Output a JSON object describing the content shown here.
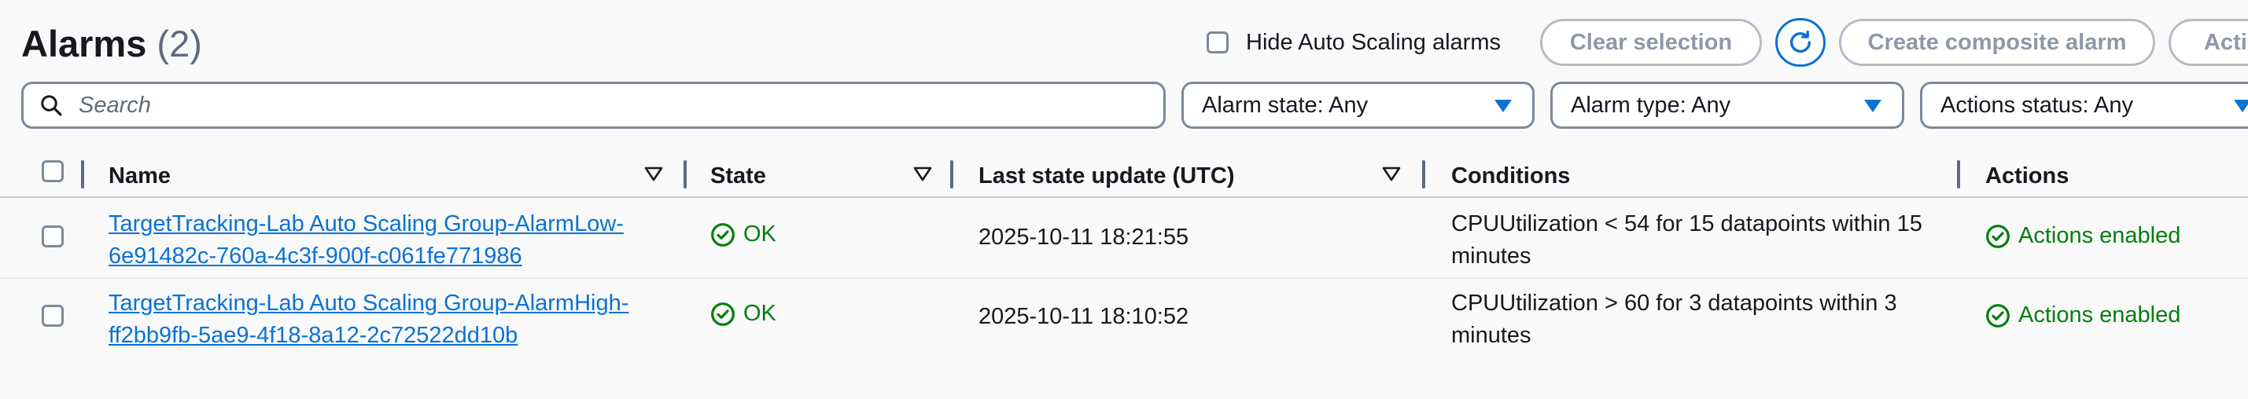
{
  "header": {
    "title": "Alarms",
    "count": "(2)",
    "hide_autoscaling_label": "Hide Auto Scaling alarms",
    "clear_selection_label": "Clear selection",
    "create_composite_label": "Create composite alarm",
    "actions_label": "Actions"
  },
  "filters": {
    "search_placeholder": "Search",
    "alarm_state": "Alarm state: Any",
    "alarm_type": "Alarm type: Any",
    "actions_status": "Actions status: Any"
  },
  "table": {
    "columns": {
      "name": "Name",
      "state": "State",
      "last_update": "Last state update (UTC)",
      "conditions": "Conditions",
      "actions": "Actions"
    },
    "rows": [
      {
        "name": "TargetTracking-Lab Auto Scaling Group-AlarmLow-6e91482c-760a-4c3f-900f-c061fe771986",
        "state": "OK",
        "last_update": "2025-10-11 18:21:55",
        "conditions": "CPUUtilization < 54 for 15 datapoints within 15 minutes",
        "actions": "Actions enabled"
      },
      {
        "name": "TargetTracking-Lab Auto Scaling Group-AlarmHigh-ff2bb9fb-5ae9-4f18-8a12-2c72522dd10b",
        "state": "OK",
        "last_update": "2025-10-11 18:10:52",
        "conditions": "CPUUtilization > 60 for 3 datapoints within 3 minutes",
        "actions": "Actions enabled"
      }
    ]
  },
  "colors": {
    "link": "#0972d3",
    "success": "#037f0c",
    "disabled_text": "#8d99a8",
    "border": "#7d8998"
  },
  "icons": [
    "refresh-icon",
    "search-icon",
    "caret-down-icon",
    "sort-icon",
    "check-circle-icon"
  ]
}
